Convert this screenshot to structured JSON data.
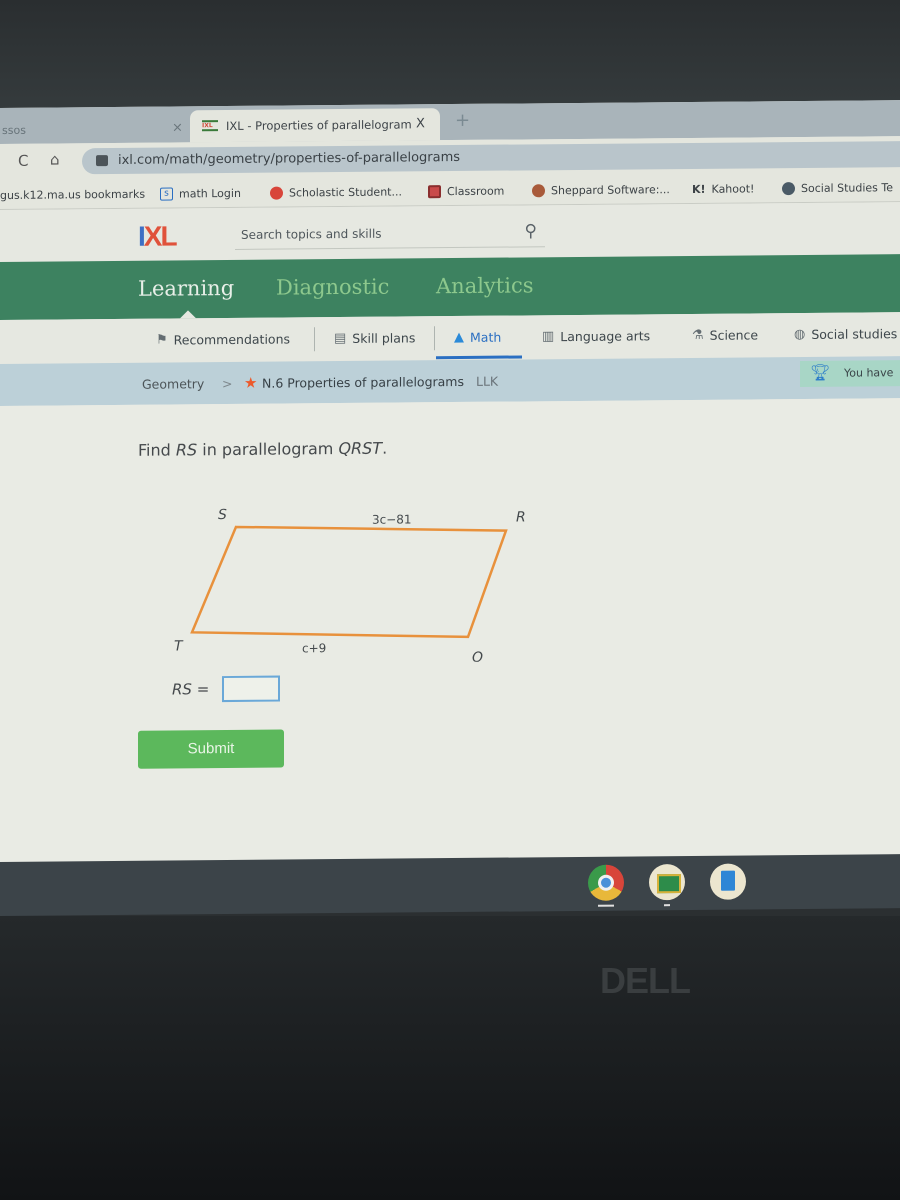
{
  "browser": {
    "tabs": [
      {
        "title": "ssos",
        "active": false,
        "close": "×"
      },
      {
        "title": "IXL - Properties of parallelogram",
        "active": true,
        "close": "X",
        "favicon": "IXL"
      }
    ],
    "new_tab": "+",
    "url": "ixl.com/math/geometry/properties-of-parallelograms",
    "bookmarks": [
      {
        "label": "gus.k12.ma.us bookmarks",
        "icon": "folder-icon"
      },
      {
        "label": "math Login",
        "icon": "s-icon"
      },
      {
        "label": "Scholastic Student...",
        "icon": "red-circle-icon"
      },
      {
        "label": "Classroom",
        "icon": "classroom-icon"
      },
      {
        "label": "Sheppard Software:...",
        "icon": "sheppard-icon"
      },
      {
        "label": "Kahoot!",
        "icon": "kahoot-icon",
        "icon_text": "K!"
      },
      {
        "label": "Social Studies Te",
        "icon": "globe-icon"
      }
    ]
  },
  "ixl": {
    "logo": {
      "i": "I",
      "xl": "XL"
    },
    "search_placeholder": "Search topics and skills",
    "main_nav": [
      {
        "label": "Learning",
        "active": true
      },
      {
        "label": "Diagnostic",
        "active": false
      },
      {
        "label": "Analytics",
        "active": false
      }
    ],
    "subject_nav": [
      {
        "label": "Recommendations",
        "icon": "recommendations-icon"
      },
      {
        "label": "Skill plans",
        "icon": "skill-plans-icon"
      },
      {
        "label": "Math",
        "icon": "math-pyramid-icon",
        "active": true
      },
      {
        "label": "Language arts",
        "icon": "book-icon"
      },
      {
        "label": "Science",
        "icon": "flask-icon"
      },
      {
        "label": "Social studies",
        "icon": "globe-icon"
      }
    ],
    "breadcrumb": {
      "subject": "Geometry",
      "separator": ">",
      "skill": "N.6 Properties of parallelograms",
      "code": "LLK"
    },
    "award": {
      "text": "You have"
    },
    "question": {
      "prompt_parts": [
        "Find ",
        "RS",
        " in parallelogram ",
        "QRST",
        "."
      ],
      "vertices": {
        "S": "S",
        "R": "R",
        "Q": "Q",
        "T": "T"
      },
      "side_labels": {
        "top": "3c−81",
        "bottom": "c+9"
      },
      "answer_label": "RS",
      "equals": "=",
      "answer_value": "",
      "submit_label": "Submit"
    },
    "colors": {
      "green_nav": "#3d8260",
      "parallelogram_stroke": "#e8913c",
      "submit": "#5cb85c",
      "math_underline": "#2b6fc2"
    }
  },
  "shelf": {
    "apps": [
      {
        "name": "Chrome"
      },
      {
        "name": "Google Classroom"
      },
      {
        "name": "Google Docs"
      }
    ]
  },
  "hardware": {
    "brand": "DELL"
  }
}
